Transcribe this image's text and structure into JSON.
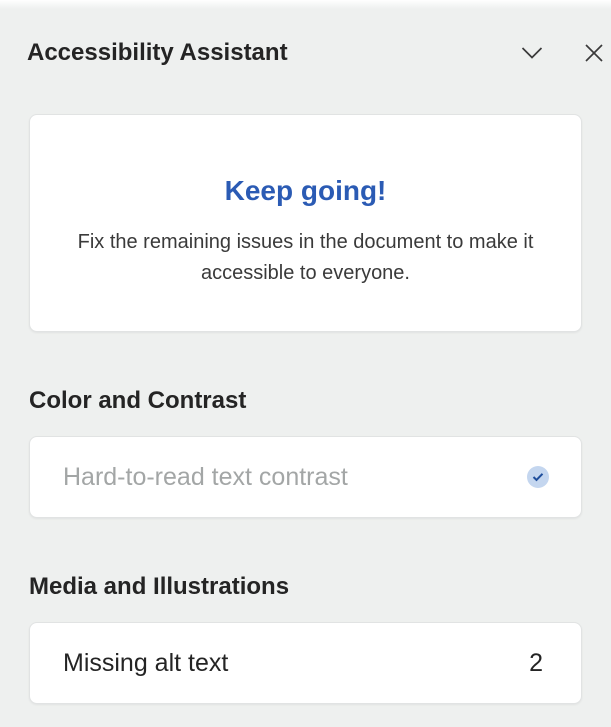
{
  "pane": {
    "title": "Accessibility Assistant",
    "collapse_icon": "chevron-down-icon",
    "close_icon": "close-icon"
  },
  "status": {
    "heading": "Keep going!",
    "message": "Fix the remaining issues in the document to make it accessible to everyone."
  },
  "sections": [
    {
      "heading": "Color and Contrast",
      "issues": [
        {
          "label": "Hard-to-read text contrast",
          "state": "resolved",
          "icon": "check-circle-icon"
        }
      ]
    },
    {
      "heading": "Media and Illustrations",
      "issues": [
        {
          "label": "Missing alt text",
          "count": "2",
          "state": "open"
        }
      ]
    }
  ],
  "colors": {
    "accent": "#2b5bb4",
    "pane_background": "#eef0ef",
    "card_background": "#ffffff",
    "resolved_text": "#a3a6a6",
    "check_badge": "#c4d6ef"
  }
}
